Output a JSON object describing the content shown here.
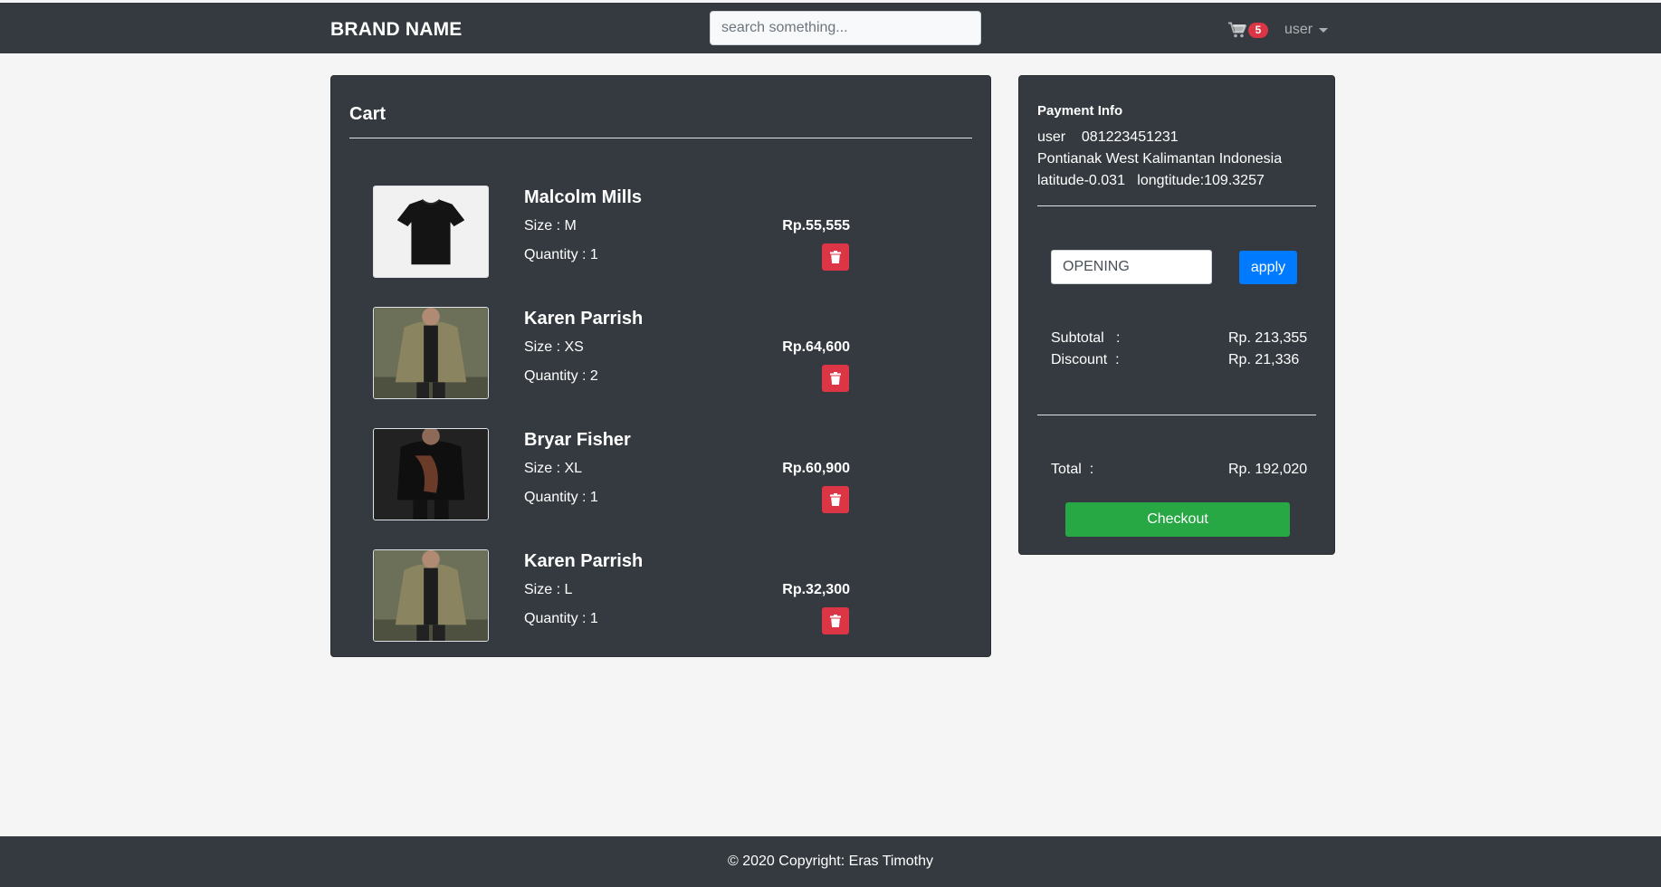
{
  "navbar": {
    "brand": "BRAND NAME",
    "search_placeholder": "search something...",
    "cart_icon": "shopping-cart-icon",
    "cart_count": "5",
    "user_label": "user"
  },
  "cart": {
    "title": "Cart",
    "items": [
      {
        "name": "Malcolm Mills",
        "size": "Size : M",
        "quantity": "Quantity : 1",
        "price": "Rp.55,555",
        "image": "black-tshirt"
      },
      {
        "name": "Karen Parrish",
        "size": "Size : XS",
        "quantity": "Quantity : 2",
        "price": "Rp.64,600",
        "image": "olive-jacket"
      },
      {
        "name": "Bryar Fisher",
        "size": "Size : XL",
        "quantity": "Quantity : 1",
        "price": "Rp.60,900",
        "image": "black-printed-shirt"
      },
      {
        "name": "Karen Parrish",
        "size": "Size : L",
        "quantity": "Quantity : 1",
        "price": "Rp.32,300",
        "image": "olive-jacket"
      }
    ]
  },
  "payment": {
    "title": "Payment Info",
    "user_line": "user    081223451231",
    "address": "Pontianak West Kalimantan Indonesia",
    "coords": "latitude-0.031   longtitude:109.3257",
    "coupon_value": "OPENING",
    "apply_label": "apply",
    "subtotal_label": "Subtotal   :",
    "subtotal_value": "Rp. 213,355",
    "discount_label": "Discount  :",
    "discount_value": "Rp. 21,336",
    "total_label": "Total  :",
    "total_value": "Rp. 192,020",
    "checkout_label": "Checkout"
  },
  "footer": {
    "copyright": "© 2020 Copyright: Eras Timothy"
  },
  "colors": {
    "dark": "#343a40",
    "danger": "#dc3545",
    "primary": "#007bff",
    "success": "#28a745"
  }
}
